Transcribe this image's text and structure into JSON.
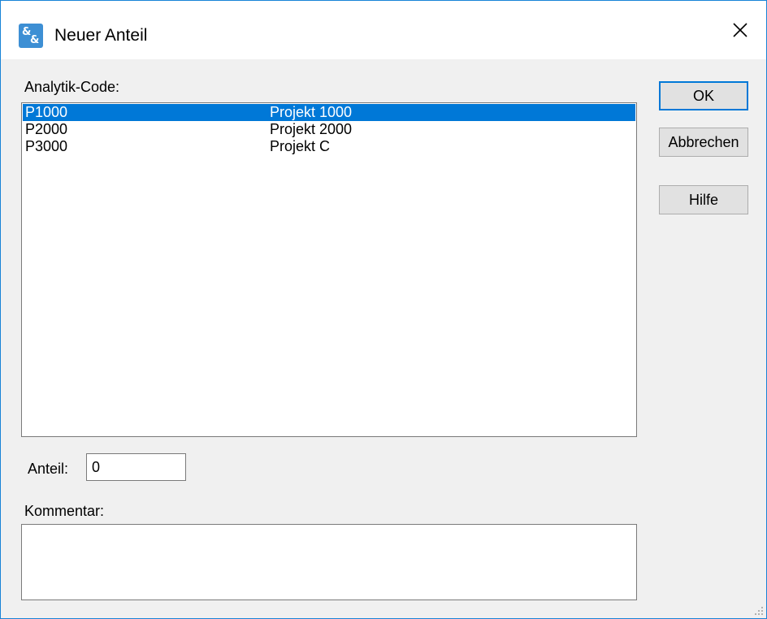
{
  "window": {
    "title": "Neuer Anteil"
  },
  "analytik": {
    "label": "Analytik-Code:",
    "items": [
      {
        "code": "P1000",
        "name": "Projekt 1000",
        "selected": true
      },
      {
        "code": "P2000",
        "name": "Projekt 2000",
        "selected": false
      },
      {
        "code": "P3000",
        "name": "Projekt C",
        "selected": false
      }
    ]
  },
  "anteil": {
    "label": "Anteil:",
    "value": "0"
  },
  "kommentar": {
    "label": "Kommentar:",
    "value": ""
  },
  "buttons": {
    "ok": "OK",
    "cancel": "Abbrechen",
    "help": "Hilfe"
  },
  "colors": {
    "accent": "#0078d7",
    "window_border": "#1883d7",
    "dialog_bg": "#f0f0f0"
  }
}
